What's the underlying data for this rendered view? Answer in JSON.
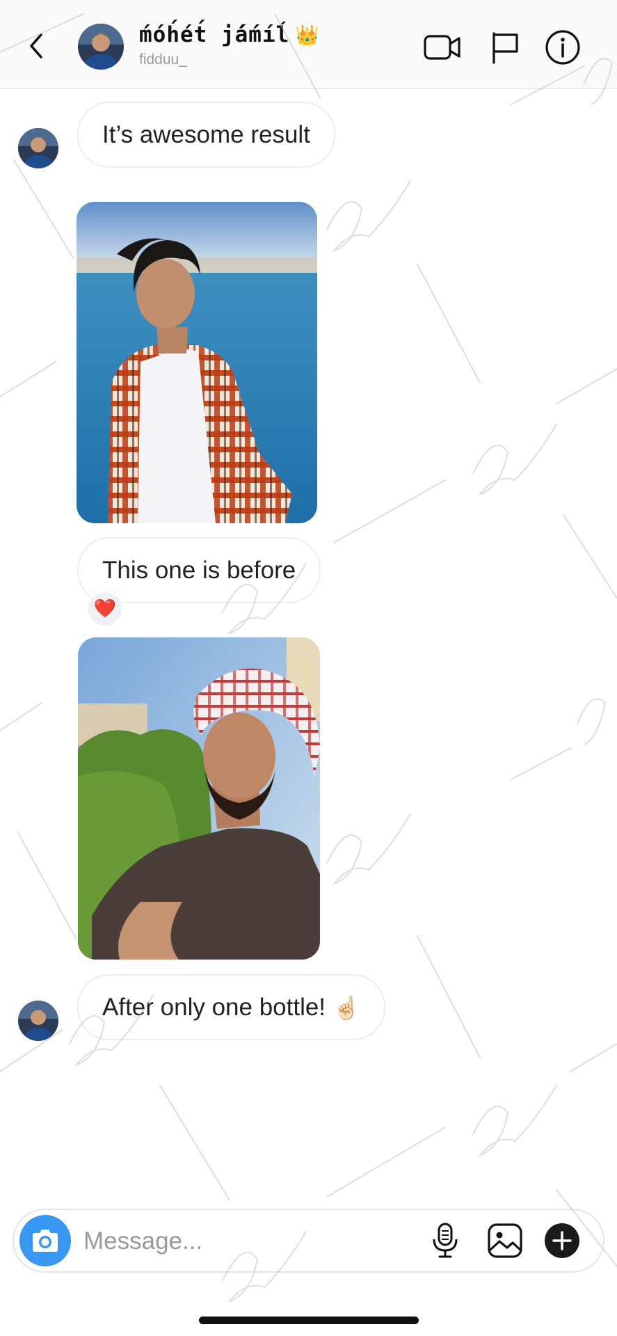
{
  "header": {
    "title": "ḿóh́ét́ j́áḿíĺ",
    "crown_emoji": "👑",
    "username": "fidduu_",
    "icons": [
      "chevron-left-icon",
      "video-camera-icon",
      "flag-icon",
      "info-icon"
    ]
  },
  "messages": [
    {
      "type": "text",
      "text": "It’s awesome result",
      "show_avatar": true
    },
    {
      "type": "image",
      "content": "photo-before"
    },
    {
      "type": "text",
      "text": "This one is before",
      "reaction": "❤️"
    },
    {
      "type": "image",
      "content": "photo-after"
    },
    {
      "type": "text",
      "text": "After only one bottle!",
      "emoji": "☝🏻",
      "show_avatar": true
    }
  ],
  "composer": {
    "placeholder": "Message...",
    "icons": [
      "camera-icon",
      "microphone-icon",
      "gallery-icon",
      "plus-icon"
    ]
  },
  "colors": {
    "accent": "#3897f0",
    "bubble_border": "#ececf2",
    "reaction_bg": "#efeff4",
    "header_bg": "#fafafa"
  }
}
